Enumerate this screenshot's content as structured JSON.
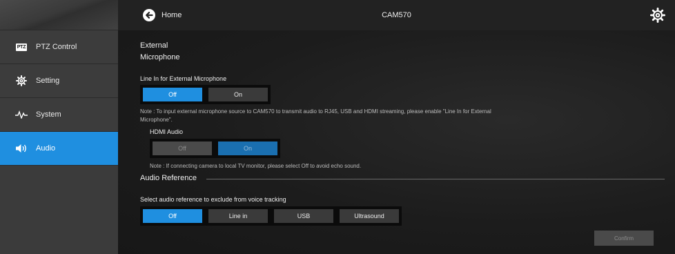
{
  "header": {
    "home_label": "Home",
    "device_name": "CAM570"
  },
  "sidebar": {
    "items": [
      {
        "label": "PTZ Control",
        "badge": "PTZ"
      },
      {
        "label": "Setting"
      },
      {
        "label": "System"
      },
      {
        "label": "Audio"
      }
    ]
  },
  "main": {
    "section_title": "External Microphone",
    "line_in": {
      "label": "Line In for External Microphone",
      "options": [
        "Off",
        "On"
      ],
      "selected": "Off",
      "note": "Note : To input external microphone source to CAM570 to transmit audio to RJ45, USB and HDMI streaming, please enable \"Line In for External Microphone\"."
    },
    "hdmi_audio": {
      "label": "HDMI Audio",
      "options": [
        "Off",
        "On"
      ],
      "selected": "On",
      "disabled": true,
      "note": "Note : If connecting camera to local TV monitor, please select Off to avoid echo sound."
    },
    "audio_reference": {
      "title": "Audio Reference",
      "label": "Select audio reference to exclude from voice tracking",
      "options": [
        "Off",
        "Line in",
        "USB",
        "Ultrasound"
      ],
      "selected": "Off"
    },
    "confirm_label": "Confirm"
  },
  "colors": {
    "accent": "#1f8fe0",
    "sidebar_bg": "#3b3b3b",
    "header_bg": "#222222"
  }
}
